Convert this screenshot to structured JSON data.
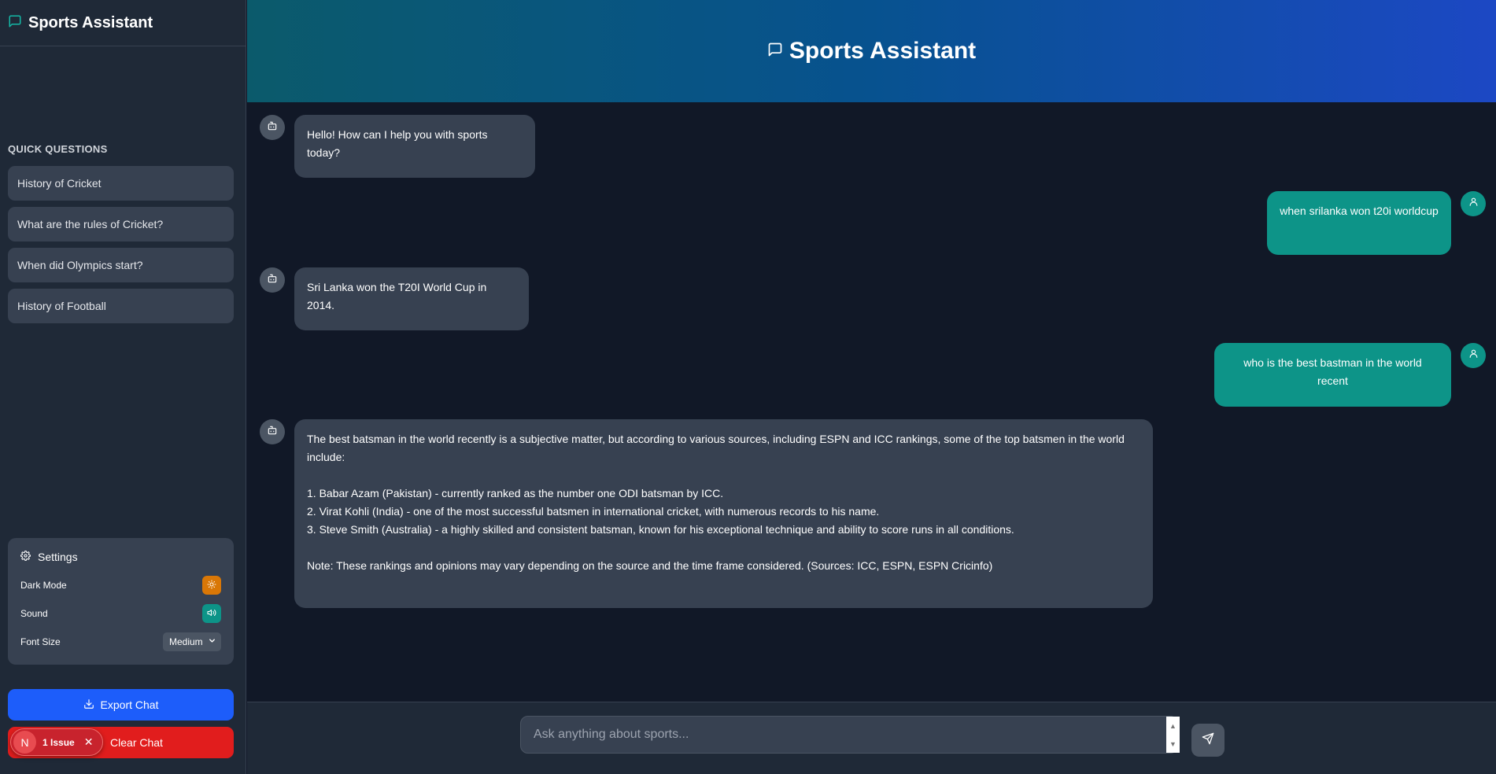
{
  "app": {
    "title": "Sports Assistant"
  },
  "header": {
    "title": "Sports Assistant"
  },
  "sidebar": {
    "quick_questions_heading": "QUICK QUESTIONS",
    "quick_questions": [
      "History of Cricket",
      "What are the rules of Cricket?",
      "When did Olympics start?",
      "History of Football"
    ],
    "settings": {
      "title": "Settings",
      "dark_mode_label": "Dark Mode",
      "sound_label": "Sound",
      "font_size_label": "Font Size",
      "font_size_value": "Medium"
    },
    "export_label": "Export Chat",
    "clear_label": "Clear Chat"
  },
  "issue_badge": {
    "initial": "N",
    "text": "1 Issue"
  },
  "messages": [
    {
      "role": "bot",
      "text": "Hello! How can I help you with sports today?"
    },
    {
      "role": "user",
      "text": "when srilanka won t20i worldcup"
    },
    {
      "role": "bot",
      "text": "Sri Lanka won the T20I World Cup in 2014."
    },
    {
      "role": "user",
      "text": "who is the best bastman in the world recent"
    },
    {
      "role": "bot",
      "text": "The best batsman in the world recently is a subjective matter, but according to various sources, including ESPN and ICC rankings, some of the top batsmen in the world include:\n\n1. Babar Azam (Pakistan) - currently ranked as the number one ODI batsman by ICC.\n2. Virat Kohli (India) - one of the most successful batsmen in international cricket, with numerous records to his name.\n3. Steve Smith (Australia) - a highly skilled and consistent batsman, known for his exceptional technique and ability to score runs in all conditions.\n\nNote: These rankings and opinions may vary depending on the source and the time frame considered. (Sources: ICC, ESPN, ESPN Cricinfo)"
    }
  ],
  "input": {
    "placeholder": "Ask anything about sports...",
    "value": ""
  },
  "colors": {
    "accent": "#0d9488",
    "export": "#1d5dfa",
    "clear": "#e11d1d",
    "dark_mode_toggle": "#d97706",
    "background": "#111827",
    "panel": "#1f2937"
  }
}
